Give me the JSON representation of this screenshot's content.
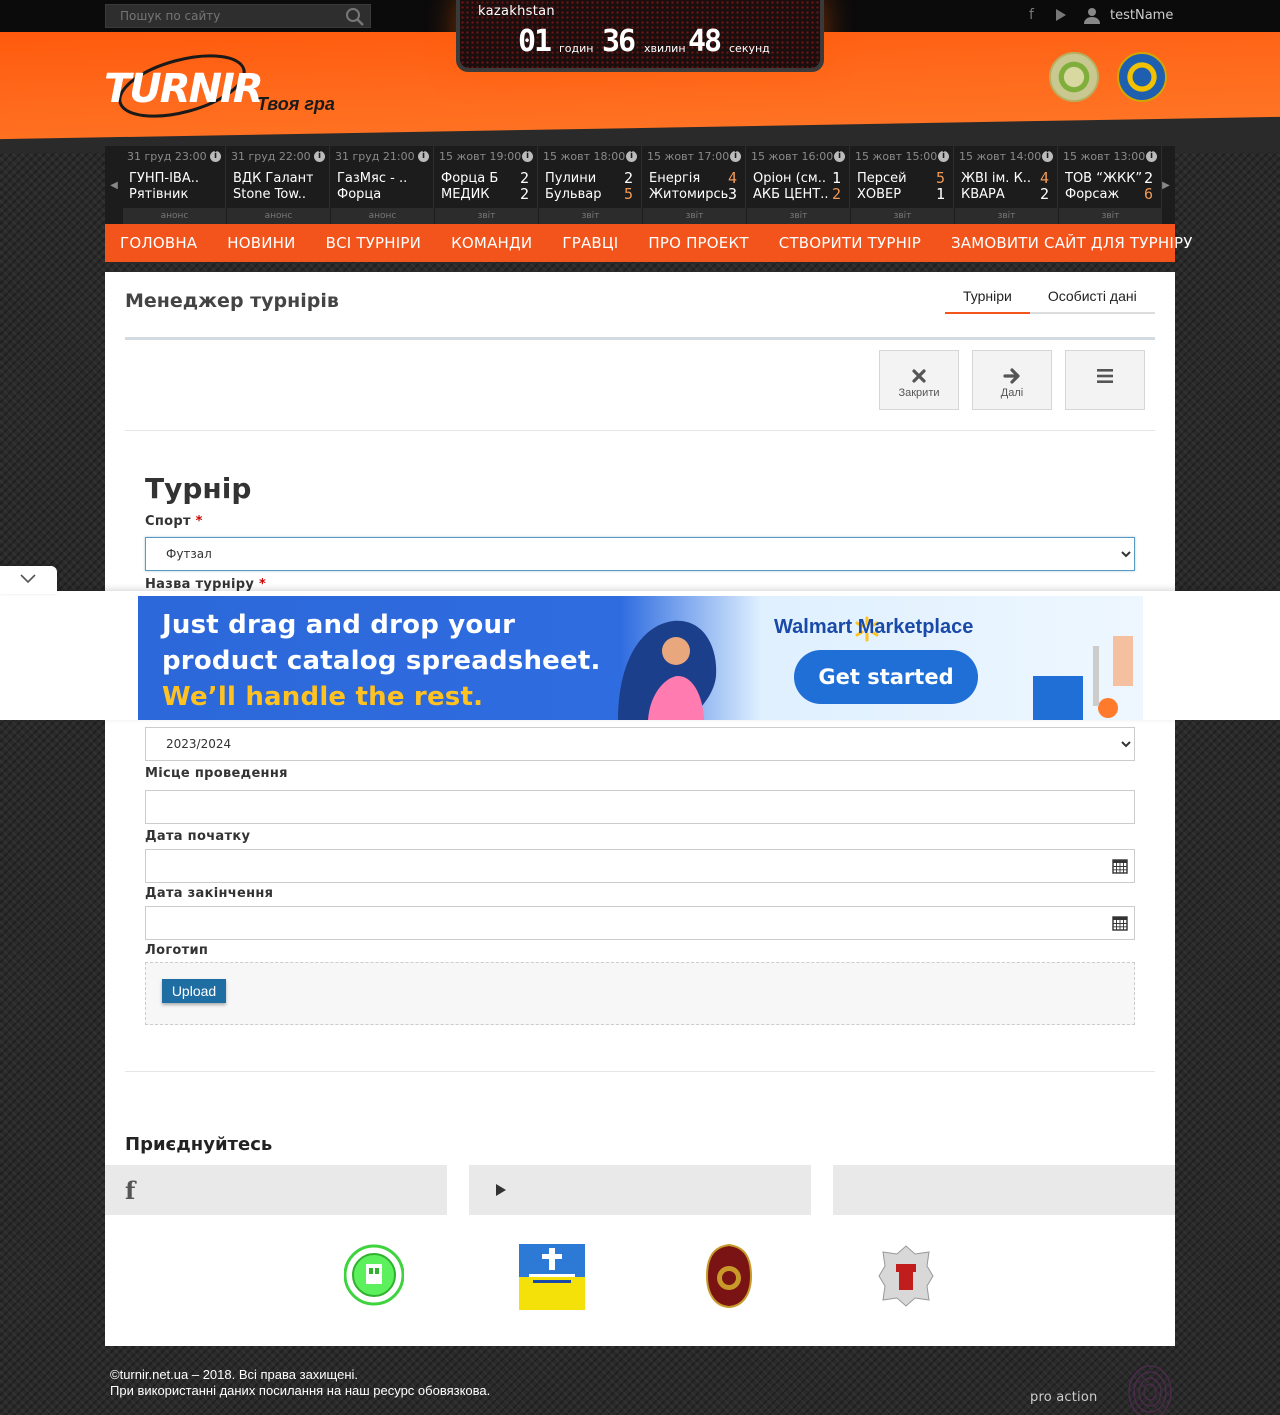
{
  "topbar": {
    "search_placeholder": "Пошук по сайту",
    "username": "testName",
    "icons": [
      "facebook-icon",
      "youtube-icon",
      "user-icon"
    ]
  },
  "countdown": {
    "city": "kazakhstan",
    "hours": "01",
    "hours_label": "годин",
    "minutes": "36",
    "minutes_label": "хвилин",
    "seconds": "48",
    "seconds_label": "секунд"
  },
  "header": {
    "logo_text": "TURNIR",
    "tagline": "Твоя гра"
  },
  "matches": [
    {
      "date": "31 груд 23:00",
      "home": "ГУНП-ІВА..",
      "away": "Рятівник",
      "home_score": "",
      "away_score": "",
      "status": "анонс"
    },
    {
      "date": "31 груд 22:00",
      "home": "ВДК Галант",
      "away": "Stone Tow..",
      "home_score": "",
      "away_score": "",
      "status": "анонс"
    },
    {
      "date": "31 груд 21:00",
      "home": "ГазМяс - ..",
      "away": "Форца",
      "home_score": "",
      "away_score": "",
      "status": "анонс"
    },
    {
      "date": "15 жовт 19:00",
      "home": "Форца Б",
      "away": "МЕДИК",
      "home_score": "2",
      "away_score": "2",
      "status": "звіт"
    },
    {
      "date": "15 жовт 18:00",
      "home": "Пулини",
      "away": "Бульвар",
      "home_score": "2",
      "away_score": "5",
      "status": "звіт"
    },
    {
      "date": "15 жовт 17:00",
      "home": "Енергія",
      "away": "Житомирсь",
      "home_score": "4",
      "away_score": "3",
      "status": "звіт"
    },
    {
      "date": "15 жовт 16:00",
      "home": "Оріон (см..",
      "away": "АКБ ЦЕНТ..",
      "home_score": "1",
      "away_score": "2",
      "status": "звіт"
    },
    {
      "date": "15 жовт 15:00",
      "home": "Персей",
      "away": "ХОВЕР",
      "home_score": "5",
      "away_score": "1",
      "status": "звіт"
    },
    {
      "date": "15 жовт 14:00",
      "home": "ЖВІ ім. К..",
      "away": "КВАРА",
      "home_score": "4",
      "away_score": "2",
      "status": "звіт"
    },
    {
      "date": "15 жовт 13:00",
      "home": "ТОВ “ЖКК”",
      "away": "Форсаж",
      "home_score": "2",
      "away_score": "6",
      "status": "звіт"
    }
  ],
  "colors": {
    "accent": "#f2541c",
    "winner_score": "#f29a55",
    "loser_score": "#ffffff",
    "link_blue": "#1f6ea3"
  },
  "nav": [
    "ГОЛОВНА",
    "НОВИНИ",
    "ВСІ ТУРНІРИ",
    "КОМАНДИ",
    "ГРАВЦІ",
    "ПРО ПРОЕКТ",
    "СТВОРИТИ ТУРНІР",
    "ЗАМОВИТИ САЙТ ДЛЯ ТУРНІРУ"
  ],
  "main": {
    "title": "Менеджер турнірів",
    "tabs": [
      {
        "label": "Турніри",
        "active": true
      },
      {
        "label": "Особисті дані",
        "active": false
      }
    ],
    "toolbar": {
      "close_label": "Закрити",
      "next_label": "Далі",
      "menu_icon": "menu-icon"
    }
  },
  "form": {
    "title": "Турнір",
    "sport_label": "Спорт",
    "sport_value": "Футзал",
    "name_label": "Назва турніру",
    "season_value": "2023/2024",
    "place_label": "Місце проведення",
    "place_value": "",
    "start_label": "Дата початку",
    "end_label": "Дата закінчення",
    "logo_label": "Логотип",
    "upload_label": "Upload",
    "required_mark": "*"
  },
  "join": {
    "title": "Приєднуйтесь",
    "socials": [
      "facebook-icon",
      "youtube-icon",
      ""
    ]
  },
  "footer": {
    "copyright": "©turnir.net.ua – 2018. Всі права захищені.",
    "notice": "При використанні даних посилання на наш ресурс обовязкова.",
    "credit": "pro action"
  },
  "ad": {
    "line1": "Just drag and drop your",
    "line2": "product catalog spreadsheet.",
    "line3": "We’ll handle the rest.",
    "brand": "Walmart Marketplace",
    "cta": "Get started"
  }
}
